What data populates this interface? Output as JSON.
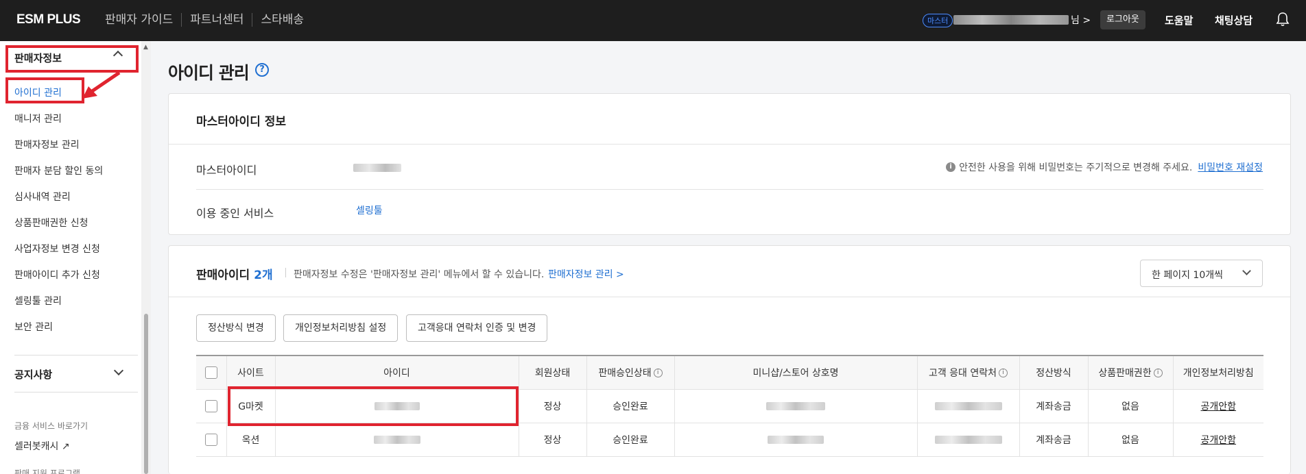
{
  "header": {
    "logo": "ESM PLUS",
    "nav": [
      "판매자 가이드",
      "파트너센터",
      "스타배송"
    ],
    "master_badge": "마스터",
    "user_suffix": "님 >",
    "logout": "로그아웃",
    "help": "도움말",
    "chat": "채팅상담",
    "bell_icon": "bell-icon"
  },
  "sidebar": {
    "section_title": "판매자정보",
    "items": [
      {
        "label": "아이디 관리",
        "active": true
      },
      {
        "label": "매니저 관리"
      },
      {
        "label": "판매자정보 관리"
      },
      {
        "label": "판매자 분담 할인 동의"
      },
      {
        "label": "심사내역 관리"
      },
      {
        "label": "상품판매권한 신청"
      },
      {
        "label": "사업자정보 변경 신청"
      },
      {
        "label": "판매아이디 추가 신청"
      },
      {
        "label": "셀링툴 관리"
      },
      {
        "label": "보안 관리"
      }
    ],
    "notice_title": "공지사항",
    "finance_label": "금융 서비스 바로가기",
    "cash_link": "셀러봇캐시",
    "cut_label": "판매 지원 프로그램"
  },
  "main": {
    "title": "아이디 관리",
    "master_card": {
      "title": "마스터아이디 정보",
      "master_id_label": "마스터아이디",
      "service_label": "이용 중인 서비스",
      "service_value": "셀링툴",
      "notice": "안전한 사용을 위해 비밀번호는 주기적으로 변경해 주세요.",
      "reset_link": "비밀번호 재설정"
    },
    "seller_card": {
      "title": "판매아이디",
      "count": "2개",
      "desc": "판매자정보 수정은 '판매자정보 관리' 메뉴에서 할 수 있습니다.",
      "link": "판매자정보 관리 >",
      "per_page": "한 페이지 10개씩",
      "buttons": [
        "정산방식 변경",
        "개인정보처리방침 설정",
        "고객응대 연락처 인증 및 변경"
      ],
      "columns": [
        "사이트",
        "아이디",
        "회원상태",
        "판매승인상태",
        "미니샵/스토어 상호명",
        "고객 응대 연락처",
        "정산방식",
        "상품판매권한",
        "개인정보처리방침"
      ],
      "rows": [
        {
          "site": "G마켓",
          "status": "정상",
          "approval": "승인완료",
          "settle": "계좌송금",
          "perm": "없음",
          "privacy": "공개안함"
        },
        {
          "site": "옥션",
          "status": "정상",
          "approval": "승인완료",
          "settle": "계좌송금",
          "perm": "없음",
          "privacy": "공개안함"
        }
      ]
    }
  },
  "colors": {
    "accent": "#1f6fd1",
    "annotation": "#e0242f",
    "topbar": "#1e1e1e"
  }
}
